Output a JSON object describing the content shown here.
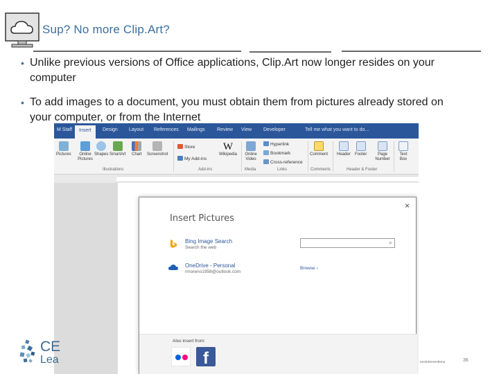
{
  "slide": {
    "title": "Sup? No more Clip.Art?",
    "bullets": [
      "Unlike previous versions of Office applications, Clip.Art now longer resides on your computer",
      "To add images to a document, you must obtain them from pictures already stored on your computer, or from the Internet"
    ],
    "bullet_glyph": "•",
    "accent_color": "#3b6e9c",
    "title_icon": "cloud-computer-icon"
  },
  "word": {
    "tabs": [
      "M Staff",
      "Insert",
      "Design",
      "Layout",
      "References",
      "Mailings",
      "Review",
      "View",
      "Developer"
    ],
    "active_tab": "Insert",
    "tell_me": "Tell me what you want to do...",
    "ribbon_color": "#2b579a",
    "buttons": {
      "pictures": "Pictures",
      "online_pictures": "Online Pictures",
      "shapes": "Shapes",
      "smartart": "SmartArt",
      "chart": "Chart",
      "screenshot": "Screenshot",
      "store": "Store",
      "my_addins": "My Add-ins",
      "wikipedia": "Wikipedia",
      "wikipedia_glyph": "W",
      "online_video": "Online Video",
      "hyperlink": "Hyperlink",
      "bookmark": "Bookmark",
      "cross_reference": "Cross-reference",
      "comment": "Comment",
      "header": "Header",
      "footer": "Footer",
      "page_number": "Page Number",
      "text_box": "Text Box"
    },
    "groups": {
      "illustrations": "Illustrations",
      "addins": "Add-ins",
      "media": "Media",
      "links": "Links",
      "comments": "Comments",
      "header_footer": "Header & Footer"
    }
  },
  "dialog": {
    "title": "Insert Pictures",
    "close": "×",
    "sources": [
      {
        "name": "Bing Image Search",
        "sub": "Search the web",
        "icon": "bing-icon"
      },
      {
        "name": "OneDrive - Personal",
        "sub": "rmoreno1958@outlook.com",
        "icon": "onedrive-icon"
      }
    ],
    "search_glyph": "⌕",
    "browse": "Browse ›",
    "also_insert": "Also insert from:",
    "services": [
      "flickr-icon",
      "facebook-icon"
    ],
    "facebook_glyph": "f"
  },
  "footer": {
    "logo_line1": "CE",
    "logo_line2": "Lea",
    "note": "ecointerventions",
    "page_number": "36"
  }
}
